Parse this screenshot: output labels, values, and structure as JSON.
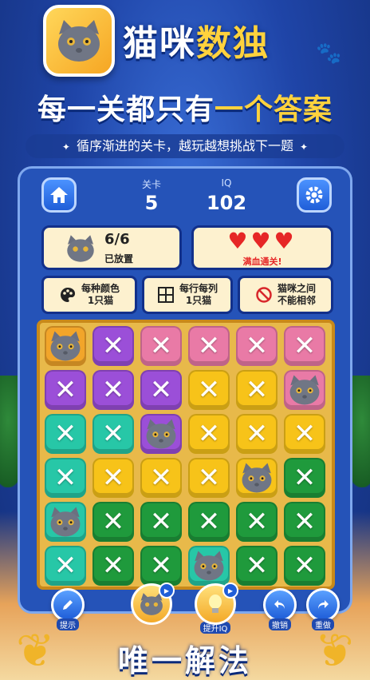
{
  "header": {
    "title_part1": "猫咪",
    "title_part2": "数独",
    "headline_part1": "每一关都只有",
    "headline_part2": "一个答案",
    "subtitle": "循序渐进的关卡，越玩越想挑战下一题"
  },
  "stats": {
    "level_label": "关卡",
    "level_value": "5",
    "iq_label": "IQ",
    "iq_value": "102"
  },
  "progress": {
    "placed_count": "6/6",
    "placed_label": "已放置",
    "hearts": 3,
    "hearts_label": "满血通关!"
  },
  "rules": [
    {
      "icon": "palette-icon",
      "line1": "每种颜色",
      "line2": "1只猫"
    },
    {
      "icon": "grid-icon",
      "line1": "每行每列",
      "line2": "1只猫"
    },
    {
      "icon": "no-entry-icon",
      "line1": "猫咪之间",
      "line2": "不能相邻"
    }
  ],
  "colors": {
    "orange": "#f2a52a",
    "purple": "#9b4fd8",
    "pink": "#e97aa6",
    "yellow": "#f7c319",
    "teal": "#27c7a7",
    "green": "#1f9a3c",
    "heart": "#e62626",
    "accent_gold": "#ffd23d"
  },
  "board": {
    "colors": [
      [
        "orange",
        "purple",
        "pink",
        "pink",
        "pink",
        "pink"
      ],
      [
        "purple",
        "purple",
        "purple",
        "yellow",
        "yellow",
        "pink"
      ],
      [
        "teal",
        "teal",
        "purple",
        "yellow",
        "yellow",
        "yellow"
      ],
      [
        "teal",
        "yellow",
        "yellow",
        "yellow",
        "yellow",
        "green"
      ],
      [
        "teal",
        "green",
        "green",
        "green",
        "green",
        "green"
      ],
      [
        "teal",
        "green",
        "green",
        "teal",
        "green",
        "green"
      ]
    ],
    "cats": [
      [
        0,
        0
      ],
      [
        1,
        5
      ],
      [
        2,
        2
      ],
      [
        3,
        4
      ],
      [
        4,
        0
      ],
      [
        5,
        3
      ]
    ]
  },
  "toolbar": {
    "hint_label": "提示",
    "iq_label": "提升IQ",
    "undo_label": "撤销",
    "redo_label": "重做"
  },
  "footer": {
    "banner": "唯一解法"
  }
}
